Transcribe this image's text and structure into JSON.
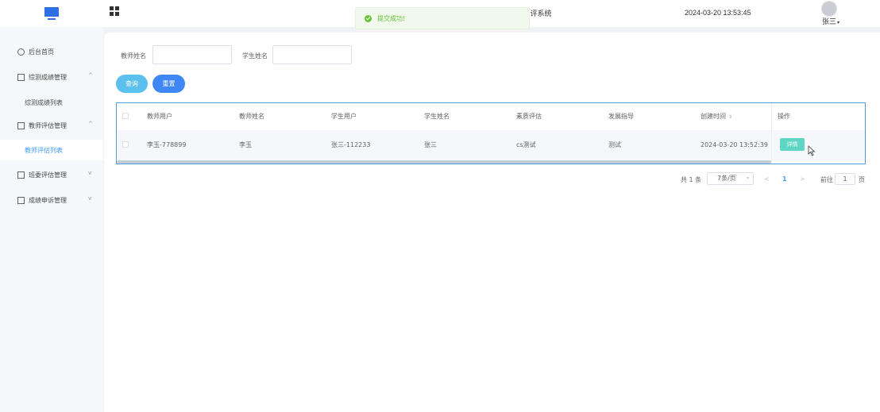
{
  "header": {
    "title_fragment": "]评系统",
    "datetime": "2024-03-20 13:53:45",
    "user_name": "张三",
    "caret": "▾"
  },
  "toast": {
    "message": "提交成功!"
  },
  "sidebar": {
    "items": [
      {
        "label": "后台首页",
        "icon": "clock-icon"
      },
      {
        "label": "综测成绩管理",
        "icon": "list-icon",
        "arrow": "^"
      },
      {
        "label": "综测成绩列表",
        "sub": true
      },
      {
        "label": "教师评估管理",
        "icon": "list-icon",
        "arrow": "^"
      },
      {
        "label": "教师评估列表",
        "sub": true,
        "active": true
      },
      {
        "label": "班委评估管理",
        "icon": "list-icon",
        "arrow": "v"
      },
      {
        "label": "成绩申诉管理",
        "icon": "list-icon",
        "arrow": "v"
      }
    ]
  },
  "filters": {
    "teacher_name_label": "教师姓名",
    "teacher_name_value": "",
    "student_name_label": "学生姓名",
    "student_name_value": ""
  },
  "buttons": {
    "search": "查询",
    "reset": "重置",
    "detail": "详情"
  },
  "table": {
    "columns": [
      "教师用户",
      "教师姓名",
      "学生用户",
      "学生姓名",
      "素质评估",
      "发展指导",
      "创建时间",
      "操作"
    ],
    "sort_glyph": "⇕",
    "rows": [
      {
        "teacher_user": "李玉-778899",
        "teacher_name": "李玉",
        "student_user": "张三-112233",
        "student_name": "张三",
        "quality_eval": "cs测试",
        "guidance": "测试",
        "created": "2024-03-20 13:52:39"
      }
    ]
  },
  "pagination": {
    "total": "共 1 条",
    "page_size": "7条/页",
    "current_page": "1",
    "prev": "<",
    "next": ">",
    "goto_label": "前往",
    "goto_value": "1",
    "page_unit": "页"
  },
  "colors": {
    "primary": "#409eff",
    "search_btn": "#5cc0ee",
    "reset_btn": "#3f87f5",
    "detail_btn": "#5fd5c3",
    "success": "#67c23a"
  }
}
